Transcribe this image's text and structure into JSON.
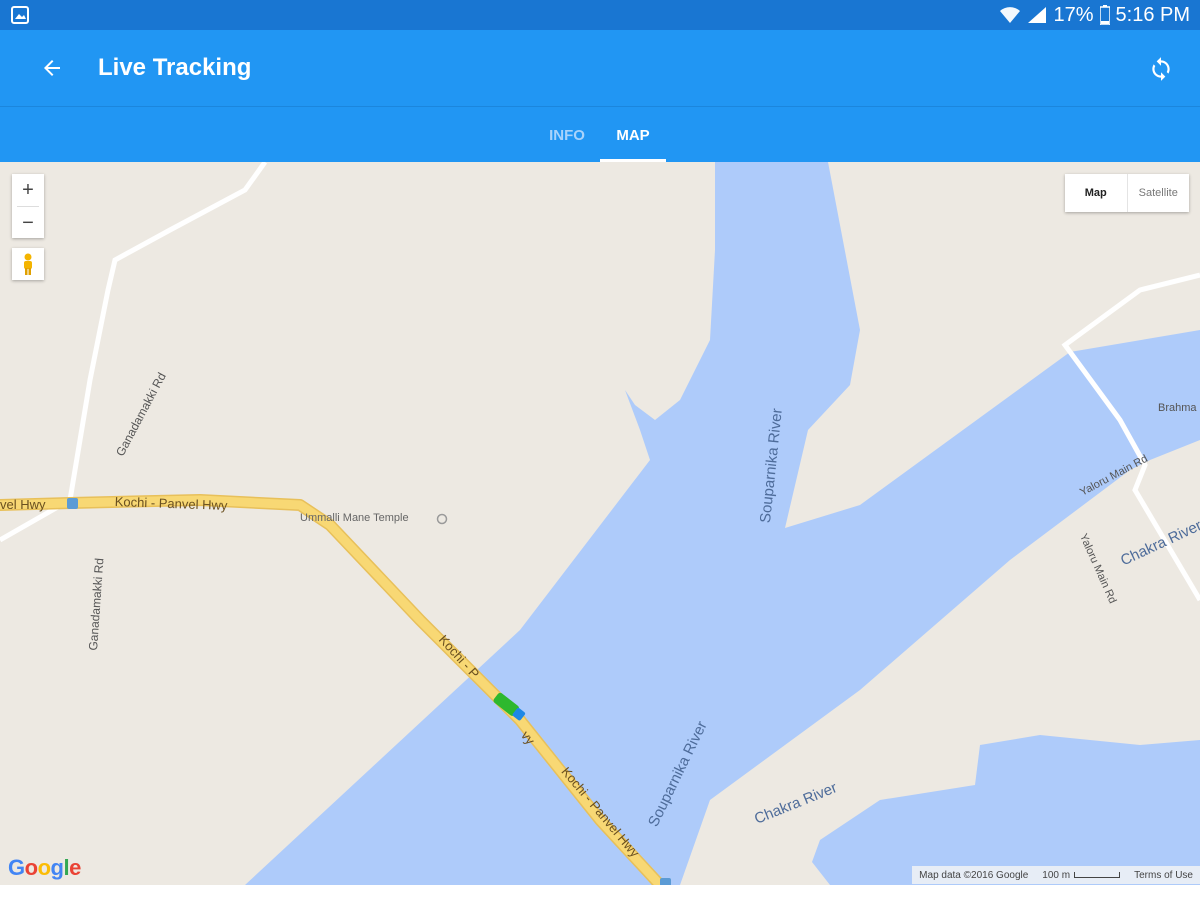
{
  "status_bar": {
    "battery": "17%",
    "time": "5:16 PM",
    "icons": [
      "gallery-icon",
      "wifi-icon",
      "signal-icon",
      "battery-icon"
    ]
  },
  "app_bar": {
    "title": "Live Tracking",
    "back_icon": "arrow-left-icon",
    "refresh_icon": "refresh-icon"
  },
  "tabs": [
    {
      "label": "INFO",
      "selected": false
    },
    {
      "label": "MAP",
      "selected": true
    }
  ],
  "map": {
    "controls": {
      "zoom_in": "+",
      "zoom_out": "−",
      "map_type": [
        "Map",
        "Satellite"
      ],
      "selected_map_type": "Map"
    },
    "labels": {
      "ganadamakki_rd_1": "Ganadamakki Rd",
      "ganadamakki_rd_2": "Ganadamakki Rd",
      "hwy_left": "vel Hwy",
      "hwy_top": "Kochi - Panvel Hwy",
      "temple": "Ummalli Mane Temple",
      "river_sou_1": "Souparnika River",
      "river_sou_2": "Souparnika River",
      "river_chakra_1": "Chakra River",
      "river_chakra_2": "Chakra River",
      "yaloru_1": "Yaloru Main Rd",
      "yaloru_2": "Yaloru Main Rd",
      "brahma": "Brahma",
      "hwy_mid": "Kochi - P",
      "hwy_mid2": "vy",
      "hwy_bottom": "Kochi - Panvel Hwy"
    },
    "google_logo": "Google",
    "attribution": {
      "map_data": "Map data ©2016 Google",
      "scale": "100 m",
      "terms": "Terms of Use"
    },
    "colors": {
      "land": "#ede9e2",
      "water": "#aecbfa",
      "highway": "#f6d36c",
      "road": "#ffffff",
      "vehicle": "#2eb82e"
    }
  }
}
